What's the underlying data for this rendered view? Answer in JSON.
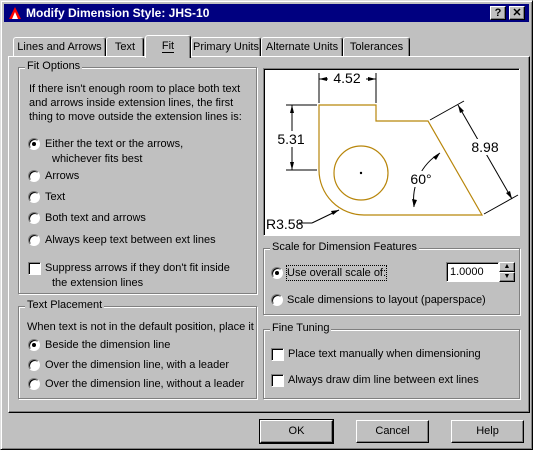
{
  "window": {
    "title": "Modify Dimension Style: JHS-10",
    "help_button": "?",
    "close_button": "✕"
  },
  "tabs": [
    "Lines and Arrows",
    "Text",
    "Fit",
    "Primary Units",
    "Alternate Units",
    "Tolerances"
  ],
  "fit_options": {
    "legend": "Fit Options",
    "description_lines": [
      "If there isn't enough room to place both text",
      "and arrows inside extension lines, the first",
      "thing to move outside the extension lines is:"
    ],
    "radios": [
      {
        "line1": "Either the text or the arrows,",
        "line2": "whichever fits best",
        "checked": true
      },
      {
        "line1": "Arrows",
        "checked": false
      },
      {
        "line1": "Text",
        "checked": false
      },
      {
        "line1": "Both text and arrows",
        "checked": false
      },
      {
        "line1": "Always keep text between ext lines",
        "checked": false
      }
    ],
    "suppress": {
      "line1": "Suppress arrows if they don't fit inside",
      "line2": "the extension lines",
      "checked": false
    }
  },
  "text_placement": {
    "legend": "Text Placement",
    "description": "When text is not in the default position, place it",
    "radios": [
      {
        "label": "Beside the dimension line",
        "checked": true
      },
      {
        "label": "Over the dimension line, with a leader",
        "checked": false
      },
      {
        "label": "Over the dimension line, without a leader",
        "checked": false
      }
    ]
  },
  "preview": {
    "dim_top": "4.52",
    "dim_left": "5.31",
    "dim_right": "8.98",
    "dim_angle": "60°",
    "dim_radius": "R3.58",
    "colors": {
      "geometry": "#b8860b",
      "dims": "#000000"
    }
  },
  "scale": {
    "legend": "Scale for Dimension Features",
    "use_overall": {
      "label": "Use overall scale of:",
      "checked": true
    },
    "value": "1.0000",
    "layout": {
      "label": "Scale dimensions to layout (paperspace)",
      "checked": false
    }
  },
  "fine_tuning": {
    "legend": "Fine Tuning",
    "place_text": {
      "label": "Place text manually when dimensioning",
      "checked": false
    },
    "draw_dim": {
      "label": "Always draw dim line between ext lines",
      "checked": false
    }
  },
  "buttons": {
    "ok": "OK",
    "cancel": "Cancel",
    "help": "Help"
  }
}
